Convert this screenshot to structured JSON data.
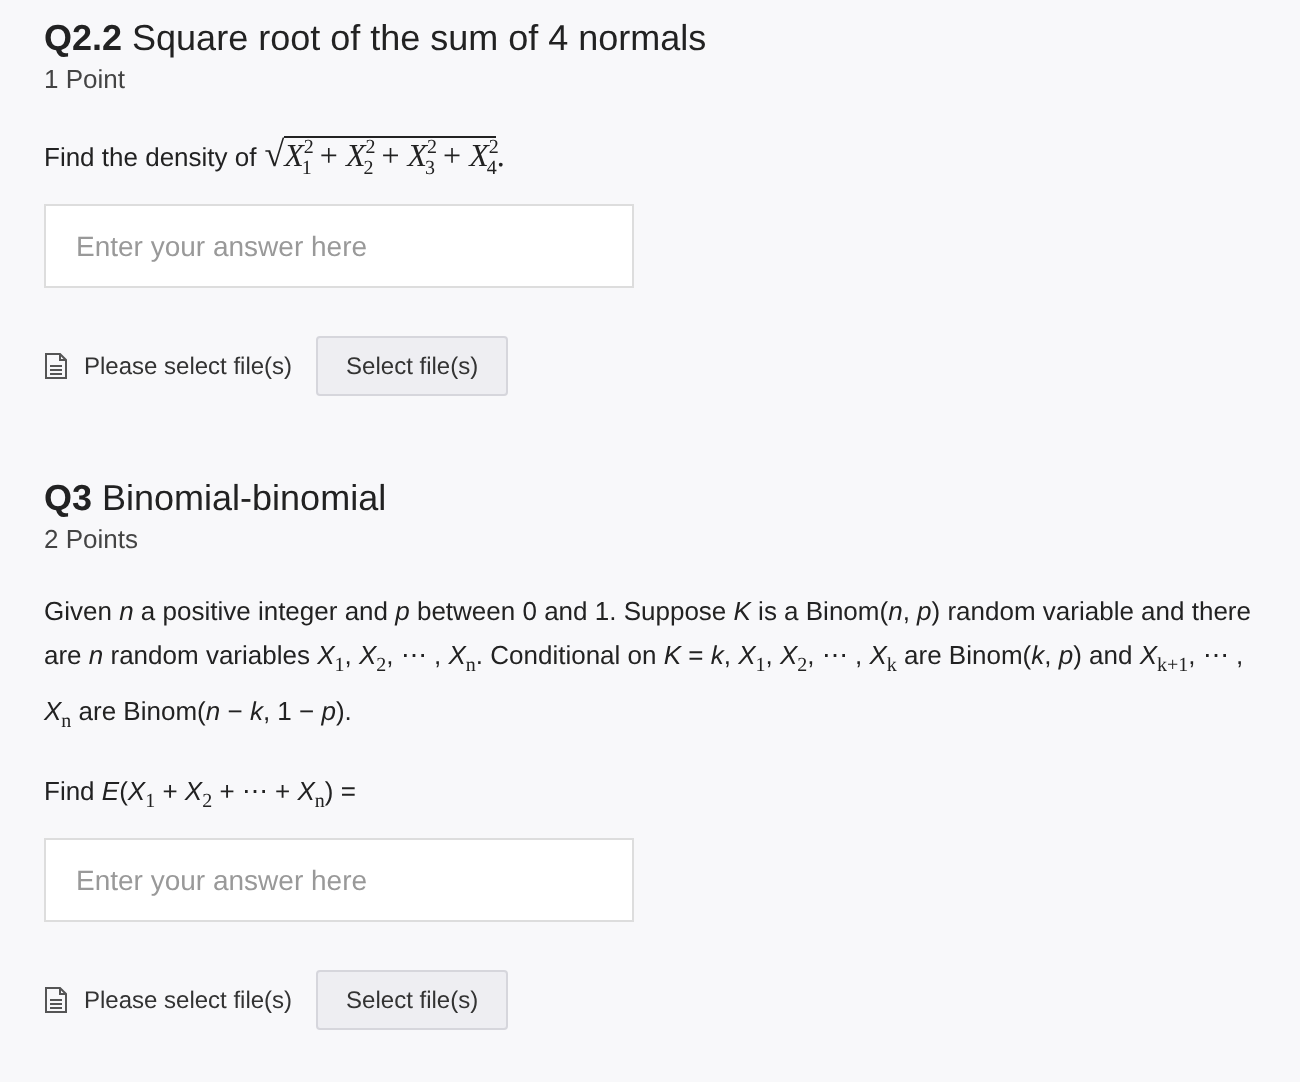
{
  "questions": [
    {
      "number": "Q2.2",
      "title": "Square root of the sum of 4 normals",
      "points": "1 Point",
      "prompt": [
        {
          "kind": "text",
          "text": "Find the density of"
        },
        {
          "kind": "sqrt",
          "sign": "√",
          "radicand": "*X*$^{2}$$_{1}$ + *X*$^{2}$$_{2}$ + *X*$^{2}$$_{3}$ + *X*$^{2}$$_{4}$",
          "after": "."
        }
      ],
      "answer": {
        "placeholder": "Enter your answer here"
      },
      "file_label": "Please select file(s)",
      "file_button": "Select file(s)"
    },
    {
      "number": "Q3",
      "title": "Binomial-binomial",
      "points": "2 Points",
      "paragraph": "Given *n* a positive integer and *p* between 0 and 1. Suppose *K* is a Binom(*n*, *p*) random variable and there are *n* random variables *X*$_{1}$, *X*$_{2}$, ⋯ , *X*$_{n}$. Conditional on *K* = *k*, *X*$_{1}$, *X*$_{2}$, ⋯ , *X*$_{k}$ are Binom(*k*, *p*) and *X*$_{k+1}$, ⋯ , *X*$_{n}$ are Binom(*n* − *k*, 1 − *p*).",
      "prompt": [
        {
          "kind": "text",
          "text": "Find *E*(*X*$_{1}$ + *X*$_{2}$ + ⋯ + *X*$_{n}$) ="
        }
      ],
      "answer": {
        "placeholder": "Enter your answer here"
      },
      "file_label": "Please select file(s)",
      "file_button": "Select file(s)"
    }
  ]
}
